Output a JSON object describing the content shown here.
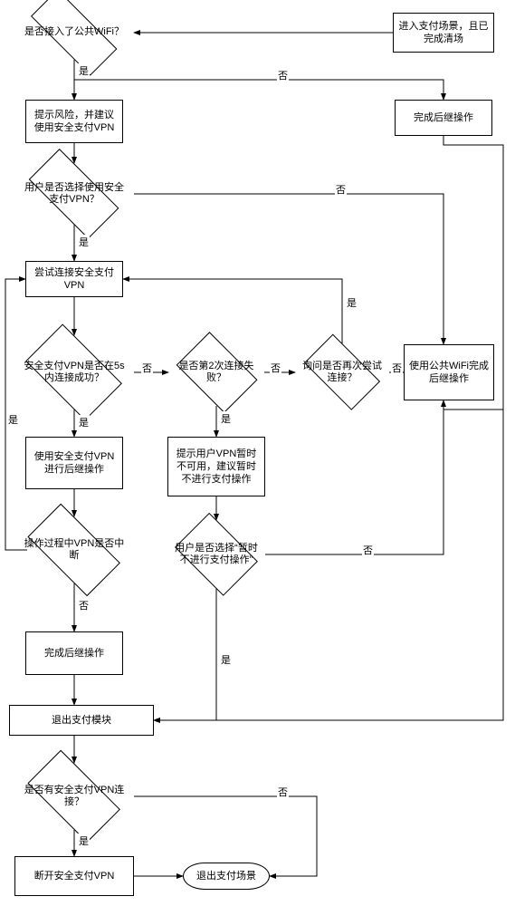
{
  "diagram": {
    "type": "flowchart",
    "language": "zh-CN",
    "labels": {
      "yes": "是",
      "no": "否"
    },
    "nodes": {
      "d_wifi": {
        "text": "是否接入了公共WiFi？",
        "shape": "decision"
      },
      "p_enter": {
        "text": "进入支付场景，且已完成清场",
        "shape": "process"
      },
      "p_risk": {
        "text": "提示风险，并建议使用安全支付VPN",
        "shape": "process"
      },
      "p_done_r": {
        "text": "完成后继操作",
        "shape": "process"
      },
      "d_choose_vpn": {
        "text": "用户是否选择使用安全支付VPN？",
        "shape": "decision"
      },
      "p_try_vpn": {
        "text": "尝试连接安全支付VPN",
        "shape": "process"
      },
      "d_5s": {
        "text": "安全支付VPN是否在5s内连接成功？",
        "shape": "decision"
      },
      "d_2nd": {
        "text": "是否第2次连接失败？",
        "shape": "decision"
      },
      "d_retry": {
        "text": "询问是否再次尝试连接？",
        "shape": "decision"
      },
      "p_pubwifi": {
        "text": "使用公共WiFi完成后继操作",
        "shape": "process"
      },
      "p_usevpn": {
        "text": "使用安全支付VPN进行后继操作",
        "shape": "process"
      },
      "p_unavail": {
        "text": "提示用户VPN暂时不可用，建议暂时不进行支付操作",
        "shape": "process"
      },
      "d_interrupt": {
        "text": "操作过程中VPN是否中断",
        "shape": "decision"
      },
      "d_skip": {
        "text": "用户是否选择“暂时不进行支付操作”",
        "shape": "decision"
      },
      "p_done_l": {
        "text": "完成后继操作",
        "shape": "process"
      },
      "p_exitmod": {
        "text": "退出支付模块",
        "shape": "process"
      },
      "d_hasvpn": {
        "text": "是否有安全支付VPN连接？",
        "shape": "decision"
      },
      "p_disc": {
        "text": "断开安全支付VPN",
        "shape": "process"
      },
      "t_exit": {
        "text": "退出支付场景",
        "shape": "terminator"
      }
    },
    "edges": [
      {
        "from": "p_enter",
        "to": "d_wifi"
      },
      {
        "from": "d_wifi",
        "to": "p_risk",
        "label": "yes"
      },
      {
        "from": "d_wifi",
        "to": "p_done_r",
        "label": "no"
      },
      {
        "from": "p_risk",
        "to": "d_choose_vpn"
      },
      {
        "from": "d_choose_vpn",
        "to": "p_try_vpn",
        "label": "yes"
      },
      {
        "from": "d_choose_vpn",
        "to": "p_pubwifi",
        "label": "no"
      },
      {
        "from": "p_try_vpn",
        "to": "d_5s"
      },
      {
        "from": "d_5s",
        "to": "p_usevpn",
        "label": "yes"
      },
      {
        "from": "d_5s",
        "to": "d_2nd",
        "label": "no"
      },
      {
        "from": "d_2nd",
        "to": "p_unavail",
        "label": "yes"
      },
      {
        "from": "d_2nd",
        "to": "d_retry",
        "label": "no"
      },
      {
        "from": "d_retry",
        "to": "p_try_vpn",
        "label": "yes"
      },
      {
        "from": "d_retry",
        "to": "p_pubwifi",
        "label": "no"
      },
      {
        "from": "p_usevpn",
        "to": "d_interrupt"
      },
      {
        "from": "d_interrupt",
        "to": "p_done_l",
        "label": "no"
      },
      {
        "from": "d_interrupt",
        "to": "p_try_vpn",
        "label": "yes"
      },
      {
        "from": "p_unavail",
        "to": "d_skip"
      },
      {
        "from": "d_skip",
        "to": "p_exitmod",
        "label": "yes"
      },
      {
        "from": "d_skip",
        "to": "p_pubwifi",
        "label": "no"
      },
      {
        "from": "p_done_l",
        "to": "p_exitmod"
      },
      {
        "from": "p_pubwifi",
        "to": "p_exitmod"
      },
      {
        "from": "p_done_r",
        "to": "p_exitmod"
      },
      {
        "from": "p_exitmod",
        "to": "d_hasvpn"
      },
      {
        "from": "d_hasvpn",
        "to": "p_disc",
        "label": "yes"
      },
      {
        "from": "d_hasvpn",
        "to": "t_exit",
        "label": "no"
      },
      {
        "from": "p_disc",
        "to": "t_exit"
      }
    ]
  }
}
